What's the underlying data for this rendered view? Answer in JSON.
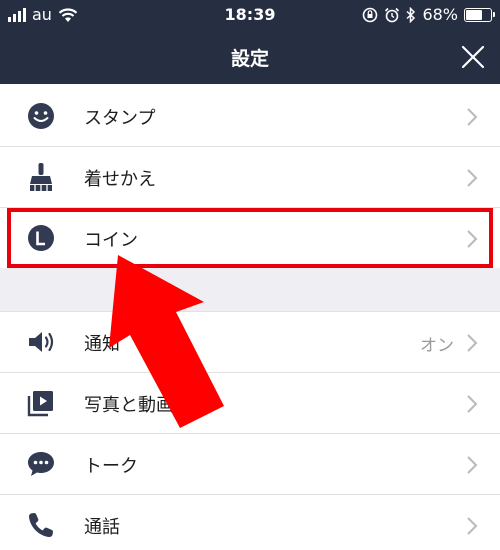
{
  "status_bar": {
    "carrier": "au",
    "time": "18:39",
    "battery": "68%",
    "battery_level": 0.68
  },
  "header": {
    "title": "設定"
  },
  "settings": {
    "items": [
      {
        "label": "スタンプ",
        "icon": "smiley-icon"
      },
      {
        "label": "着せかえ",
        "icon": "brush-icon"
      },
      {
        "label": "コイン",
        "icon": "coin-icon"
      }
    ],
    "items2": [
      {
        "label": "通知",
        "icon": "speaker-icon",
        "value": "オン"
      },
      {
        "label": "写真と動画",
        "icon": "photo-video-icon"
      },
      {
        "label": "トーク",
        "icon": "chat-bubble-icon"
      },
      {
        "label": "通話",
        "icon": "phone-icon"
      }
    ]
  },
  "colors": {
    "header_bg": "#262e42",
    "icon": "#323b52",
    "highlight": "#e8000b",
    "arrow": "#ff0000"
  }
}
